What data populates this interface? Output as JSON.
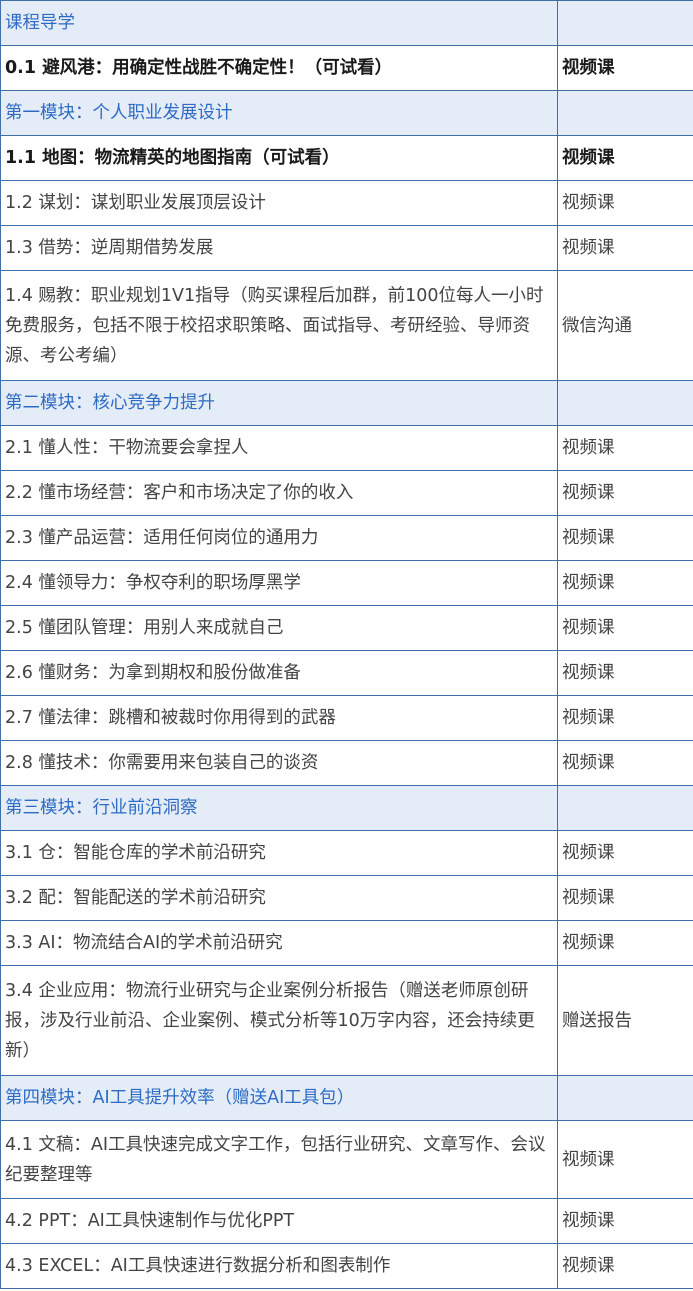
{
  "rows": [
    {
      "kind": "section",
      "title": "课程导学",
      "type": ""
    },
    {
      "kind": "bold",
      "title": "0.1 避风港：用确定性战胜不确定性！（可试看）",
      "type": "视频课"
    },
    {
      "kind": "section",
      "title": "第一模块：个人职业发展设计",
      "type": ""
    },
    {
      "kind": "bold",
      "title": "1.1 地图：物流精英的地图指南（可试看）",
      "type": "视频课"
    },
    {
      "kind": "normal",
      "title": "1.2 谋划：谋划职业发展顶层设计",
      "type": "视频课"
    },
    {
      "kind": "normal",
      "title": "1.3 借势：逆周期借势发展",
      "type": "视频课"
    },
    {
      "kind": "normal",
      "title": "1.4 赐教：职业规划1V1指导（购买课程后加群，前100位每人一小时免费服务，包括不限于校招求职策略、面试指导、考研经验、导师资源、考公考编）",
      "type": "微信沟通"
    },
    {
      "kind": "section",
      "title": "第二模块：核心竞争力提升",
      "type": ""
    },
    {
      "kind": "normal",
      "title": "2.1 懂人性：干物流要会拿捏人",
      "type": "视频课"
    },
    {
      "kind": "normal",
      "title": "2.2 懂市场经营：客户和市场决定了你的收入",
      "type": "视频课"
    },
    {
      "kind": "normal",
      "title": "2.3 懂产品运营：适用任何岗位的通用力",
      "type": "视频课"
    },
    {
      "kind": "normal",
      "title": "2.4 懂领导力：争权夺利的职场厚黑学",
      "type": "视频课"
    },
    {
      "kind": "normal",
      "title": "2.5 懂团队管理：用别人来成就自己",
      "type": "视频课"
    },
    {
      "kind": "normal",
      "title": "2.6 懂财务：为拿到期权和股份做准备",
      "type": "视频课"
    },
    {
      "kind": "normal",
      "title": "2.7 懂法律：跳槽和被裁时你用得到的武器",
      "type": "视频课"
    },
    {
      "kind": "normal",
      "title": "2.8 懂技术：你需要用来包装自己的谈资",
      "type": "视频课"
    },
    {
      "kind": "section",
      "title": "第三模块：行业前沿洞察",
      "type": ""
    },
    {
      "kind": "normal",
      "title": "3.1 仓：智能仓库的学术前沿研究",
      "type": "视频课"
    },
    {
      "kind": "normal",
      "title": "3.2 配：智能配送的学术前沿研究",
      "type": "视频课"
    },
    {
      "kind": "normal",
      "title": "3.3 AI：物流结合AI的学术前沿研究",
      "type": "视频课"
    },
    {
      "kind": "normal",
      "title": "3.4 企业应用：物流行业研究与企业案例分析报告（赠送老师原创研报，涉及行业前沿、企业案例、模式分析等10万字内容，还会持续更新）",
      "type": "赠送报告"
    },
    {
      "kind": "section",
      "title": "第四模块：AI工具提升效率（赠送AI工具包）",
      "type": ""
    },
    {
      "kind": "normal",
      "title": "4.1 文稿：AI工具快速完成文字工作，包括行业研究、文章写作、会议纪要整理等",
      "type": "视频课"
    },
    {
      "kind": "normal",
      "title": "4.2 PPT：AI工具快速制作与优化PPT",
      "type": "视频课"
    },
    {
      "kind": "normal",
      "title": "4.3 EXCEL：AI工具快速进行数据分析和图表制作",
      "type": "视频课"
    }
  ]
}
